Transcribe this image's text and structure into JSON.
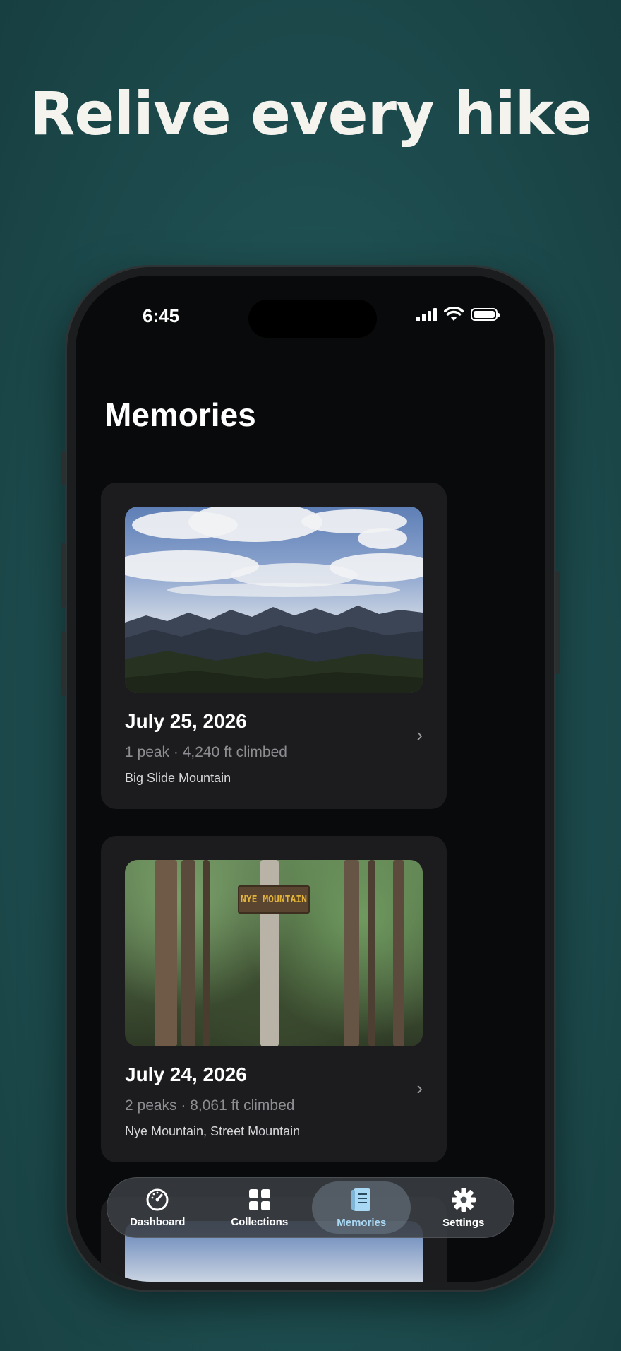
{
  "headline": "Relive every hike",
  "status_bar": {
    "time": "6:45"
  },
  "screen": {
    "title": "Memories"
  },
  "memories": [
    {
      "date": "July 25, 2026",
      "stats": "1 peak · 4,240 ft climbed",
      "peaks": "Big Slide Mountain"
    },
    {
      "date": "July 24, 2026",
      "stats": "2 peaks · 8,061 ft climbed",
      "peaks": "Nye Mountain, Street Mountain",
      "sign_text": "NYE MOUNTAIN"
    }
  ],
  "tabs": [
    {
      "label": "Dashboard",
      "icon": "speedometer-icon"
    },
    {
      "label": "Collections",
      "icon": "grid-icon"
    },
    {
      "label": "Memories",
      "icon": "journal-icon",
      "active": true
    },
    {
      "label": "Settings",
      "icon": "gear-icon"
    }
  ],
  "colors": {
    "background": "#1f5052",
    "accent": "#a9d8f5",
    "card": "#1c1c1e"
  }
}
